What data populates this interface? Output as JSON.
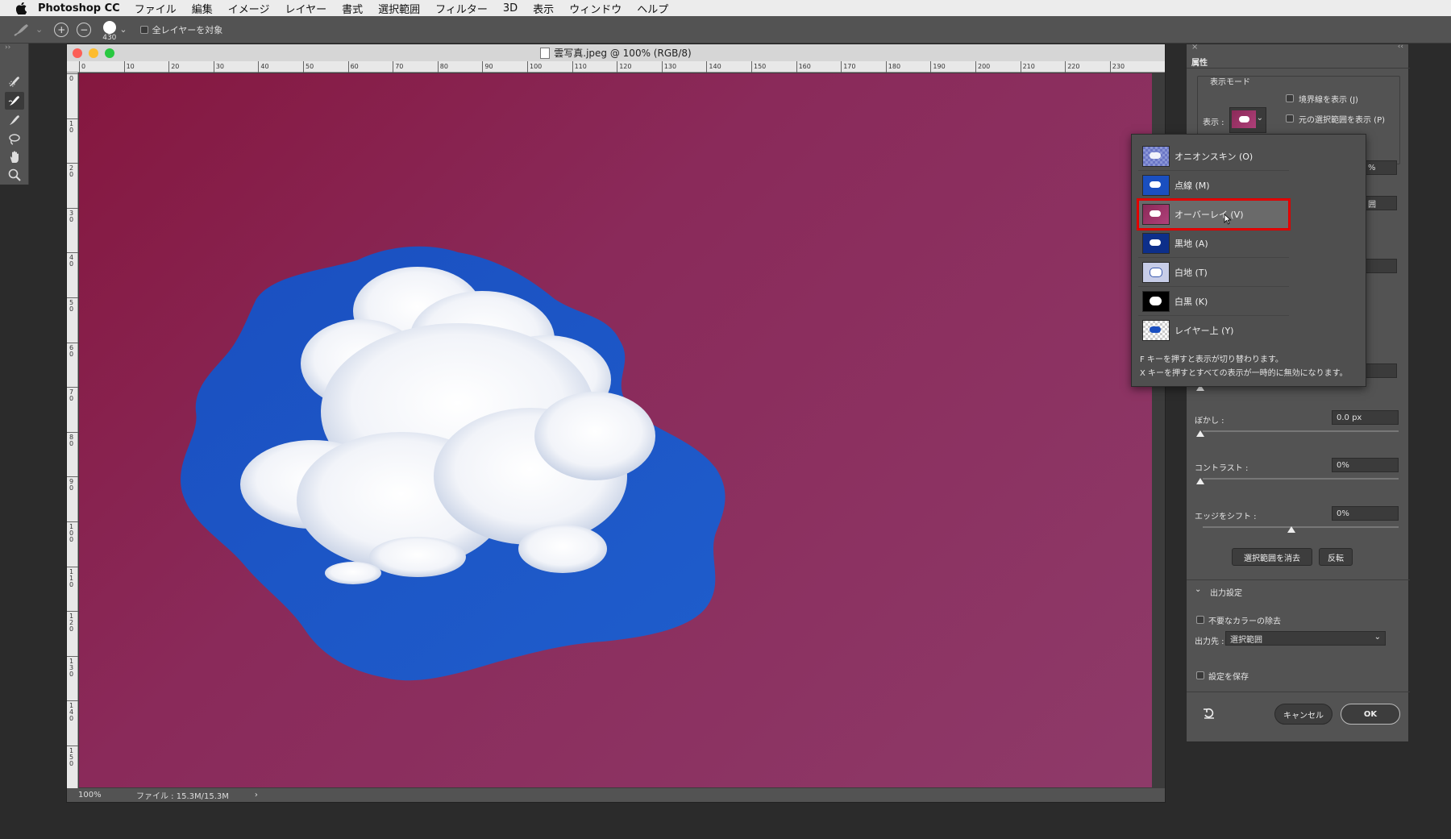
{
  "menubar": {
    "app_name": "Photoshop CC",
    "items": [
      "ファイル",
      "編集",
      "イメージ",
      "レイヤー",
      "書式",
      "選択範囲",
      "フィルター",
      "3D",
      "表示",
      "ウィンドウ",
      "ヘルプ"
    ]
  },
  "options_bar": {
    "brush_size": "430",
    "sample_all_layers_label": "全レイヤーを対象"
  },
  "document": {
    "title": "雲写真.jpeg @ 100% (RGB/8)",
    "ruler_h": [
      "0",
      "10",
      "20",
      "30",
      "40",
      "50",
      "60",
      "70",
      "80",
      "90",
      "100",
      "110",
      "120",
      "130",
      "140",
      "150",
      "160",
      "170",
      "180",
      "190",
      "200",
      "210",
      "220",
      "230"
    ],
    "ruler_v": [
      "0",
      "1\n0",
      "2\n0",
      "3\n0",
      "4\n0",
      "5\n0",
      "6\n0",
      "7\n0",
      "8\n0",
      "9\n0",
      "1\n0\n0",
      "1\n1\n0",
      "1\n2\n0",
      "1\n3\n0",
      "1\n4\n0",
      "1\n5\n0"
    ],
    "status_zoom": "100%",
    "status_file": "ファイル : 15.3M/15.3M",
    "status_arrow": "›"
  },
  "properties_panel": {
    "title": "属性",
    "view_mode_header": "表示モード",
    "view_label": "表示 :",
    "show_edge_label": "境界線を表示 (J)",
    "show_original_label": "元の選択範囲を表示 (P)",
    "feather_label": "ぼかし :",
    "feather_value": "0.0 px",
    "contrast_label": "コントラスト :",
    "contrast_value": "0%",
    "shift_edge_label": "エッジをシフト :",
    "shift_edge_value": "0%",
    "clear_selection_button": "選択範囲を消去",
    "invert_button": "反転",
    "output_settings_header": "出力設定",
    "decontaminate_label": "不要なカラーの除去",
    "output_to_label": "出力先 :",
    "output_to_value": "選択範囲",
    "remember_settings_label": "設定を保存",
    "cancel_button": "キャンセル",
    "ok_button": "OK",
    "partial_value_1": "%",
    "partial_value_2": "囲"
  },
  "dropdown": {
    "items": [
      {
        "label": "オニオンスキン (O)",
        "thumb": "onion"
      },
      {
        "label": "点線 (M)",
        "thumb": "marching"
      },
      {
        "label": "オーバーレイ (V)",
        "thumb": "overlay",
        "selected": true
      },
      {
        "label": "黒地 (A)",
        "thumb": "black"
      },
      {
        "label": "白地 (T)",
        "thumb": "white"
      },
      {
        "label": "白黒 (K)",
        "thumb": "bw"
      },
      {
        "label": "レイヤー上 (Y)",
        "thumb": "layers"
      }
    ],
    "note_1": "F キーを押すと表示が切り替わります。",
    "note_2": "X キーを押すとすべての表示が一時的に無効になります。",
    "highlight_color": "#e00000"
  },
  "colors": {
    "overlay_magenta": "#8a2a58",
    "sky_blue": "#1a54c4",
    "panel_gray": "#535353"
  }
}
